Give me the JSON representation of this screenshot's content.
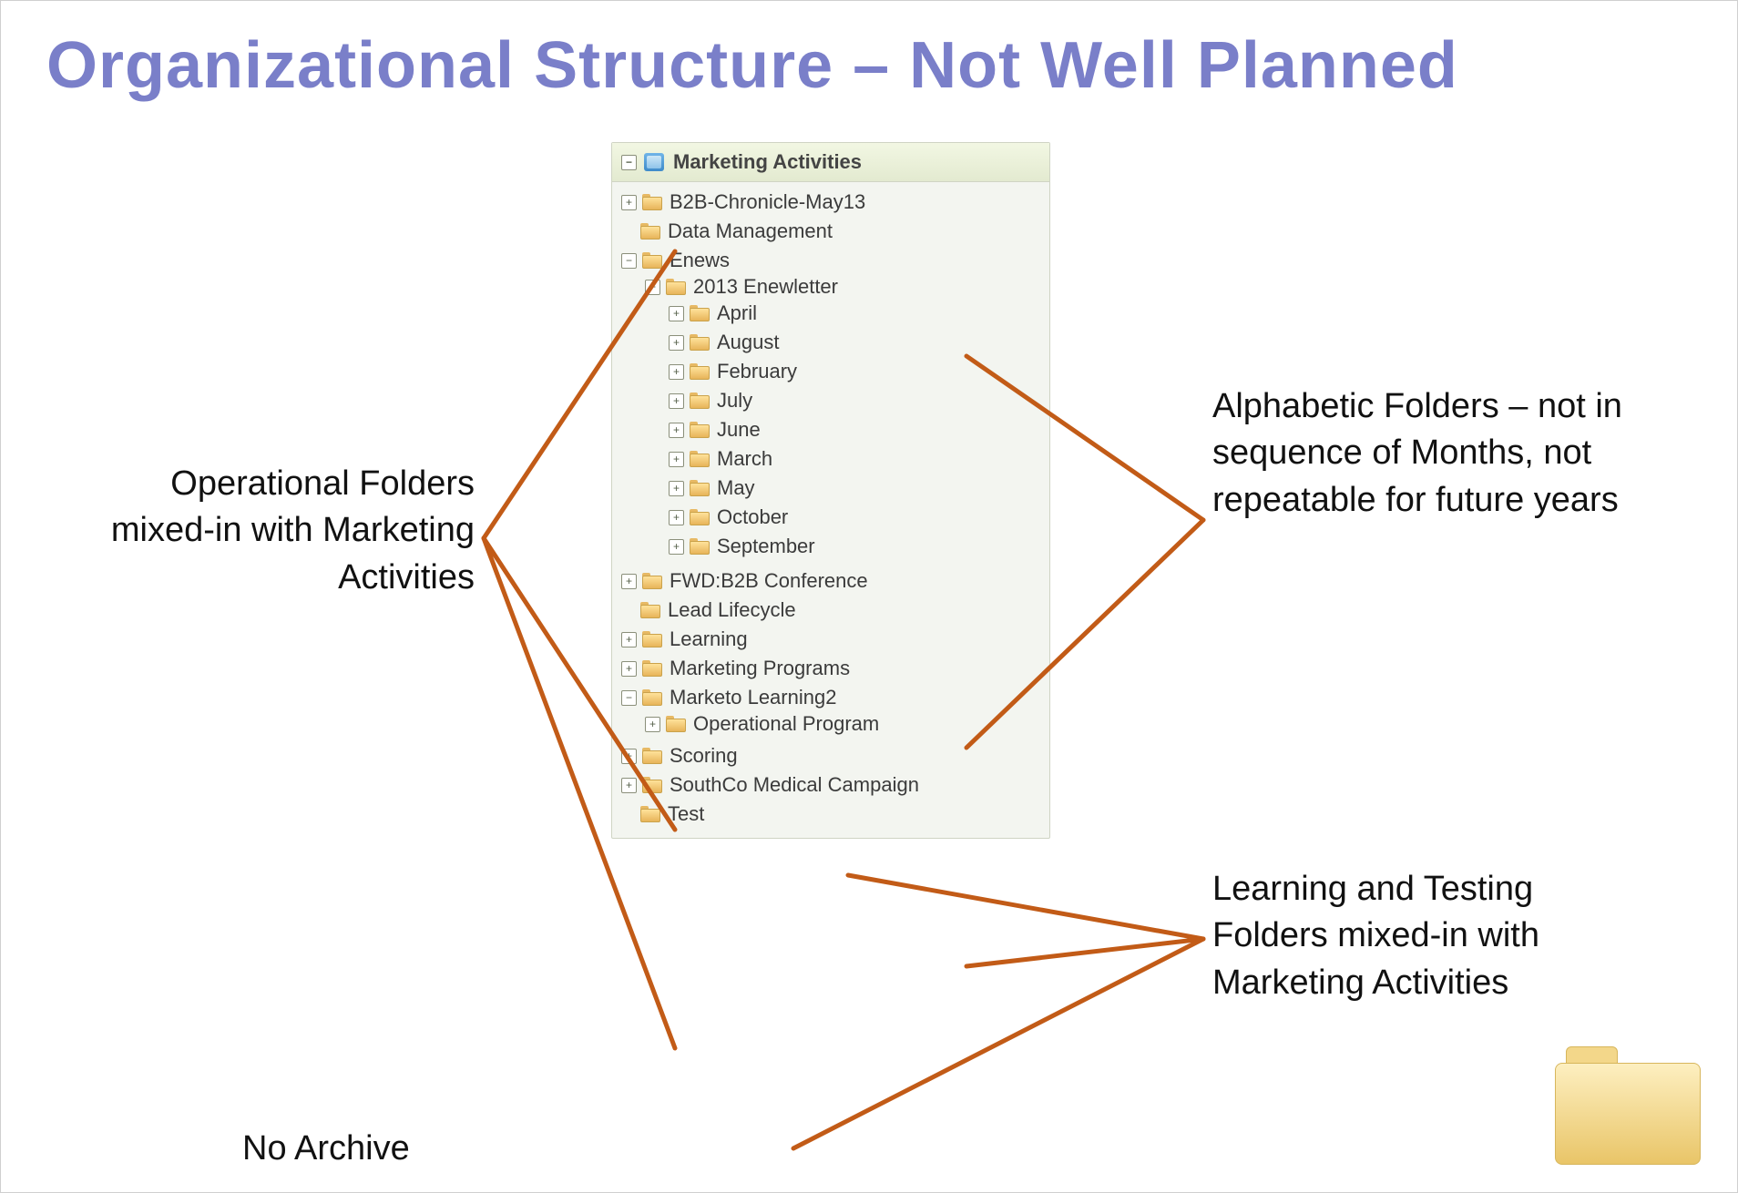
{
  "title": "Organizational Structure – Not Well Planned",
  "annotations": {
    "left": "Operational Folders mixed-in with Marketing Activities",
    "rightTop": "Alphabetic Folders – not in sequence of Months, not repeatable for future years",
    "rightBot": "Learning and Testing Folders mixed-in with Marketing Activities",
    "bottom": "No Archive"
  },
  "tree": {
    "rootLabel": "Marketing Activities",
    "nodes": [
      {
        "label": "B2B-Chronicle-May13",
        "toggle": "plus"
      },
      {
        "label": "Data Management",
        "toggle": "none"
      },
      {
        "label": "Enews",
        "toggle": "minus",
        "children": [
          {
            "label": "2013 Enewletter",
            "toggle": "minus",
            "children": [
              {
                "label": "April",
                "toggle": "plus"
              },
              {
                "label": "August",
                "toggle": "plus"
              },
              {
                "label": "February",
                "toggle": "plus"
              },
              {
                "label": "July",
                "toggle": "plus"
              },
              {
                "label": "June",
                "toggle": "plus"
              },
              {
                "label": "March",
                "toggle": "plus"
              },
              {
                "label": "May",
                "toggle": "plus"
              },
              {
                "label": "October",
                "toggle": "plus"
              },
              {
                "label": "September",
                "toggle": "plus"
              }
            ]
          }
        ]
      },
      {
        "label": "FWD:B2B Conference",
        "toggle": "plus"
      },
      {
        "label": "Lead Lifecycle",
        "toggle": "none"
      },
      {
        "label": "Learning",
        "toggle": "plus"
      },
      {
        "label": "Marketing Programs",
        "toggle": "plus"
      },
      {
        "label": "Marketo Learning2",
        "toggle": "minus",
        "children": [
          {
            "label": "Operational Program",
            "toggle": "plus"
          }
        ]
      },
      {
        "label": "Scoring",
        "toggle": "plus"
      },
      {
        "label": "SouthCo Medical Campaign",
        "toggle": "plus"
      },
      {
        "label": "Test",
        "toggle": "none"
      }
    ]
  }
}
